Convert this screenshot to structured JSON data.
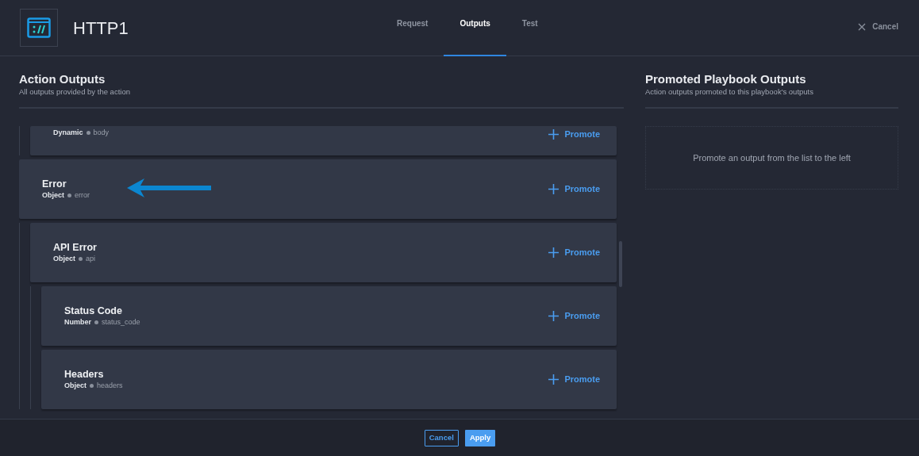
{
  "header": {
    "title": "HTTP1",
    "tabs": [
      {
        "label": "Request",
        "selected": false
      },
      {
        "label": "Outputs",
        "selected": true
      },
      {
        "label": "Test",
        "selected": false
      }
    ],
    "cancel": "Cancel"
  },
  "action_outputs": {
    "title": "Action Outputs",
    "subtitle": "All outputs provided by the action",
    "items": [
      {
        "children": [
          {
            "type": "Dynamic",
            "key": "body",
            "promote": "Promote"
          }
        ]
      },
      {
        "title": "Error",
        "type": "Object",
        "key": "error",
        "promote": "Promote",
        "children": [
          {
            "title": "API Error",
            "type": "Object",
            "key": "api",
            "promote": "Promote",
            "children": [
              {
                "title": "Status Code",
                "type": "Number",
                "key": "status_code",
                "promote": "Promote"
              },
              {
                "title": "Headers",
                "type": "Object",
                "key": "headers",
                "promote": "Promote"
              }
            ]
          }
        ]
      }
    ]
  },
  "promoted_outputs": {
    "title": "Promoted Playbook Outputs",
    "subtitle": "Action outputs promoted to this playbook's outputs",
    "empty_message": "Promote an output from the list to the left"
  },
  "footer": {
    "buttons": [
      {
        "label": "Cancel",
        "kind": "secondary"
      },
      {
        "label": "Apply",
        "kind": "primary"
      }
    ]
  }
}
